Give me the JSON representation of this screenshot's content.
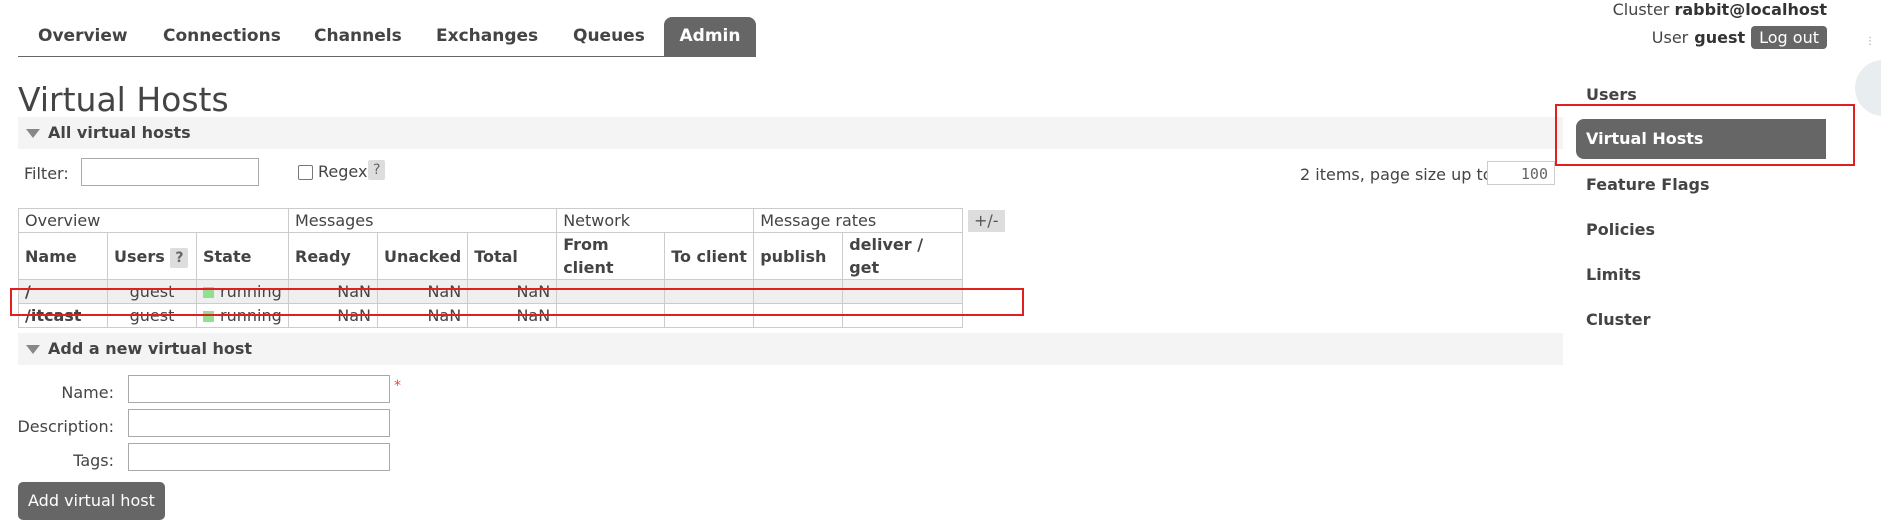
{
  "nav": {
    "tabs": [
      {
        "label": "Overview"
      },
      {
        "label": "Connections"
      },
      {
        "label": "Channels"
      },
      {
        "label": "Exchanges"
      },
      {
        "label": "Queues"
      },
      {
        "label": "Admin",
        "active": true
      }
    ]
  },
  "header": {
    "cluster_prefix": "Cluster",
    "cluster_name": "rabbit@localhost",
    "user_prefix": "User",
    "user_name": "guest",
    "logout_label": "Log out"
  },
  "page": {
    "title": "Virtual Hosts"
  },
  "vhosts_section": {
    "title": "All virtual hosts",
    "filter_label": "Filter:",
    "filter_value": "",
    "regex_label": "Regex",
    "regex_help": "?",
    "regex_checked": false,
    "items_info": "2 items, page size up to",
    "page_size": "100",
    "columns_toggle": "+/-",
    "group_headers": [
      "Overview",
      "Messages",
      "Network",
      "Message rates"
    ],
    "column_headers": [
      "Name",
      "Users",
      "State",
      "Ready",
      "Unacked",
      "Total",
      "From client",
      "To client",
      "publish",
      "deliver / get"
    ],
    "users_help": "?",
    "rows": [
      {
        "name": "/",
        "users": "guest",
        "state": "running",
        "ready": "NaN",
        "unacked": "NaN",
        "total": "NaN",
        "from_client": "",
        "to_client": "",
        "publish": "",
        "deliver_get": ""
      },
      {
        "name": "/itcast",
        "users": "guest",
        "state": "running",
        "ready": "NaN",
        "unacked": "NaN",
        "total": "NaN",
        "from_client": "",
        "to_client": "",
        "publish": "",
        "deliver_get": ""
      }
    ],
    "state_color": "#8fe08f"
  },
  "add_section": {
    "title": "Add a new virtual host",
    "name_label": "Name:",
    "name_value": "",
    "required_mark": "*",
    "description_label": "Description:",
    "description_value": "",
    "tags_label": "Tags:",
    "tags_value": "",
    "submit_label": "Add virtual host"
  },
  "sidebar": {
    "items": [
      {
        "label": "Users"
      },
      {
        "label": "Virtual Hosts",
        "active": true
      },
      {
        "label": "Feature Flags"
      },
      {
        "label": "Policies"
      },
      {
        "label": "Limits"
      },
      {
        "label": "Cluster"
      }
    ]
  },
  "colors": {
    "accent": "#666666",
    "highlight": "#e02020"
  }
}
